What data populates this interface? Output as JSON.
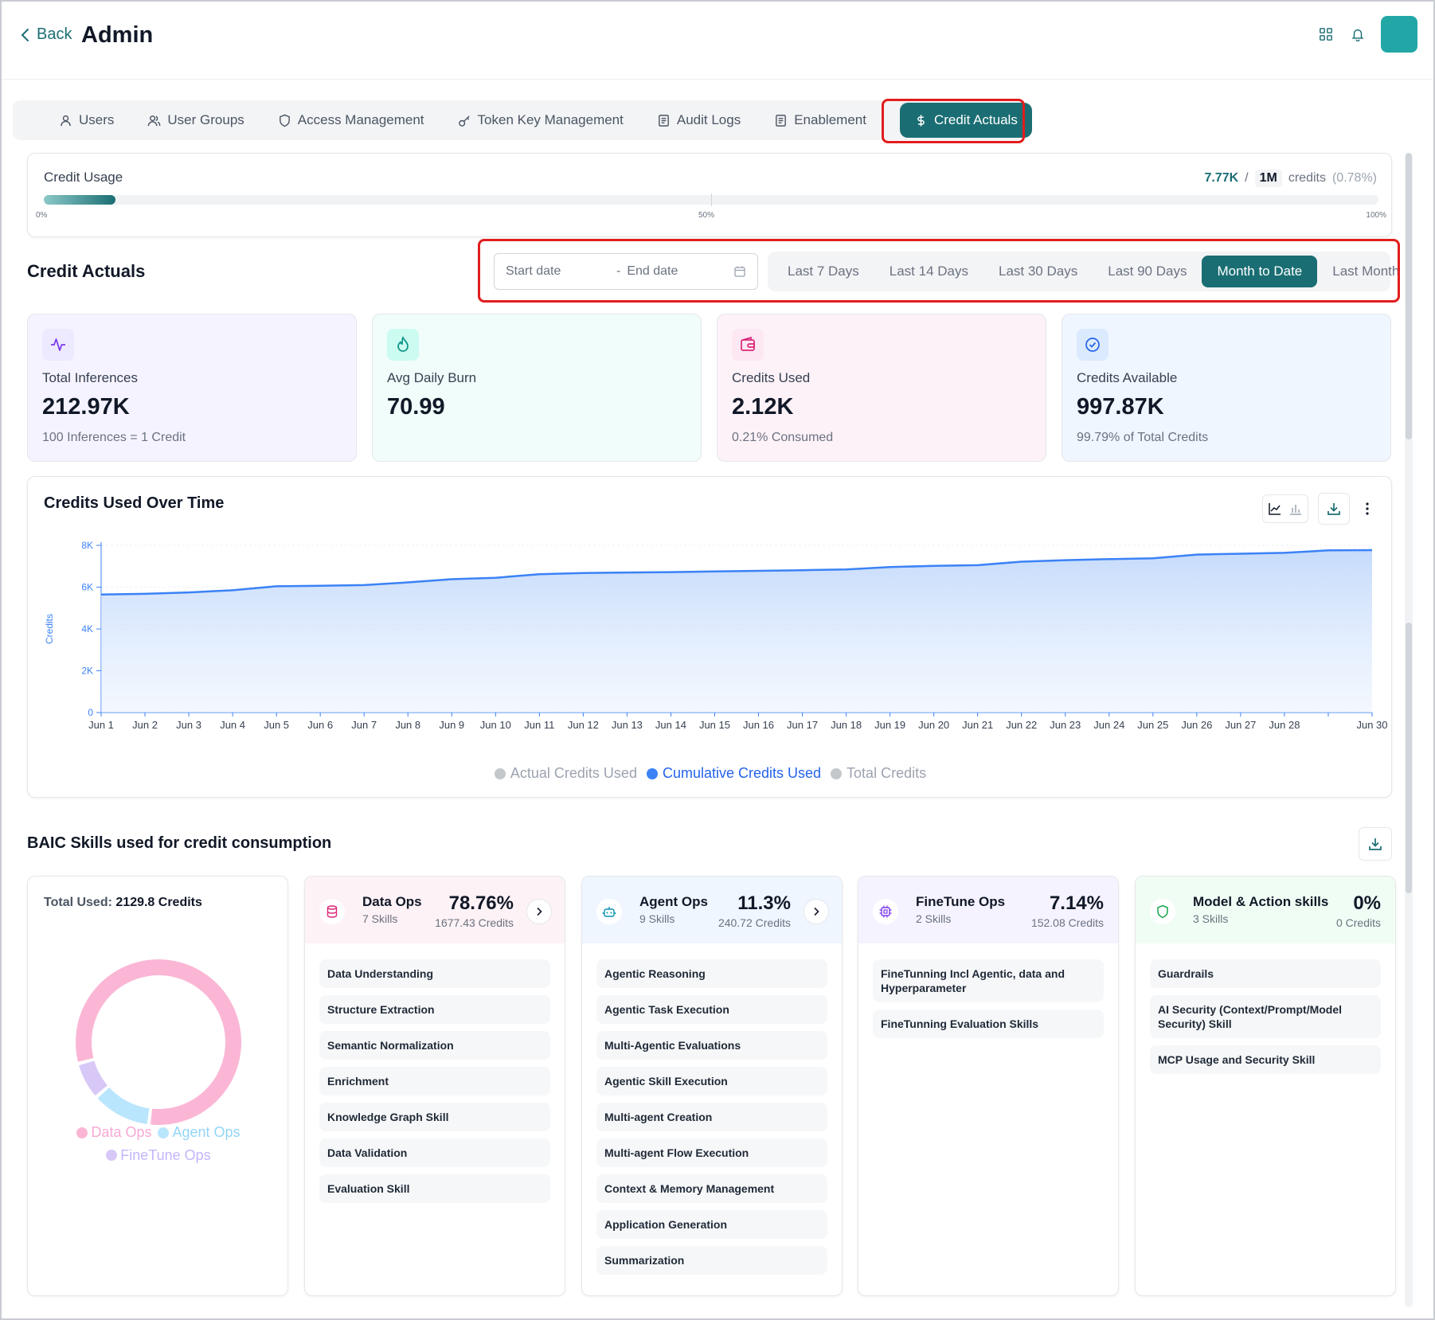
{
  "header": {
    "back_label": "Back",
    "title": "Admin"
  },
  "tabs": [
    {
      "label": "Users",
      "icon": "user-icon"
    },
    {
      "label": "User Groups",
      "icon": "users-icon"
    },
    {
      "label": "Access Management",
      "icon": "shield-icon"
    },
    {
      "label": "Token Key Management",
      "icon": "key-icon"
    },
    {
      "label": "Audit Logs",
      "icon": "log-icon"
    },
    {
      "label": "Enablement",
      "icon": "book-icon"
    },
    {
      "label": "Credit Actuals",
      "icon": "dollar-icon",
      "active": true
    }
  ],
  "usage": {
    "title": "Credit Usage",
    "used": "7.77K",
    "slash": "/",
    "total": "1M",
    "unit": "credits",
    "pct": "(0.78%)",
    "fill_fraction": 0.0078,
    "tick_0": "0%",
    "tick_50": "50%",
    "tick_100": "100%"
  },
  "actuals": {
    "title": "Credit Actuals",
    "start_placeholder": "Start date",
    "dash": "-",
    "end_placeholder": "End date",
    "presets": [
      "Last 7 Days",
      "Last 14 Days",
      "Last 30 Days",
      "Last 90 Days",
      "Month to Date",
      "Last Month"
    ],
    "active_preset": "Month to Date"
  },
  "stats": [
    {
      "label": "Total Inferences",
      "value": "212.97K",
      "sub": "100 Inferences = 1 Credit",
      "icon": "activity-icon",
      "bg": "#f5f3ff",
      "ic_bg": "#ede9fe",
      "ic_color": "#7c3aed"
    },
    {
      "label": "Avg Daily Burn",
      "value": "70.99",
      "sub": "",
      "icon": "flame-icon",
      "bg": "#f0fdfa",
      "ic_bg": "#ccfbf1",
      "ic_color": "#0d9488"
    },
    {
      "label": "Credits Used",
      "value": "2.12K",
      "sub": "0.21% Consumed",
      "icon": "wallet-icon",
      "bg": "#fdf2f8",
      "ic_bg": "#fce7f3",
      "ic_color": "#db2777"
    },
    {
      "label": "Credits Available",
      "value": "997.87K",
      "sub": "99.79% of Total Credits",
      "icon": "check-circle-icon",
      "bg": "#eff6ff",
      "ic_bg": "#dbeafe",
      "ic_color": "#2563eb"
    }
  ],
  "chart": {
    "title": "Credits Used Over Time"
  },
  "chart_data": {
    "type": "area",
    "title": "Credits Used Over Time",
    "ylabel": "Credits",
    "ylim": [
      0,
      8000
    ],
    "yticks": [
      0,
      2000,
      4000,
      6000,
      8000
    ],
    "ytick_labels": [
      "0",
      "2K",
      "4K",
      "6K",
      "8K"
    ],
    "x": [
      "Jun 1",
      "Jun 2",
      "Jun 3",
      "Jun 4",
      "Jun 5",
      "Jun 6",
      "Jun 7",
      "Jun 8",
      "Jun 9",
      "Jun 10",
      "Jun 11",
      "Jun 12",
      "Jun 13",
      "Jun 14",
      "Jun 15",
      "Jun 16",
      "Jun 17",
      "Jun 18",
      "Jun 19",
      "Jun 20",
      "Jun 21",
      "Jun 22",
      "Jun 23",
      "Jun 24",
      "Jun 25",
      "Jun 26",
      "Jun 27",
      "Jun 28",
      "Jun 29",
      "Jun 30"
    ],
    "x_labels_shown": [
      "Jun 1",
      "Jun 2",
      "Jun 3",
      "Jun 4",
      "Jun 5",
      "Jun 6",
      "Jun 7",
      "Jun 8",
      "Jun 9",
      "Jun 10",
      "Jun 11",
      "Jun 12",
      "Jun 13",
      "Jun 14",
      "Jun 15",
      "Jun 16",
      "Jun 17",
      "Jun 18",
      "Jun 19",
      "Jun 20",
      "Jun 21",
      "Jun 22",
      "Jun 23",
      "Jun 24",
      "Jun 25",
      "Jun 26",
      "Jun 27",
      "Jun 28",
      "",
      "Jun 30"
    ],
    "series": [
      {
        "name": "Cumulative Credits Used",
        "color": "#3b82f6",
        "values": [
          5650,
          5680,
          5750,
          5850,
          6040,
          6070,
          6100,
          6230,
          6380,
          6450,
          6620,
          6680,
          6700,
          6720,
          6750,
          6780,
          6810,
          6850,
          6960,
          7020,
          7050,
          7220,
          7290,
          7340,
          7380,
          7560,
          7600,
          7640,
          7760,
          7770
        ]
      }
    ],
    "legend": [
      {
        "name": "Actual Credits Used",
        "color": "#c4c7cc",
        "text_color": "#9ca3af"
      },
      {
        "name": "Cumulative Credits Used",
        "color": "#3b82f6",
        "text_color": "#2563eb"
      },
      {
        "name": "Total Credits",
        "color": "#c4c7cc",
        "text_color": "#9ca3af"
      }
    ],
    "legend_position": "bottom-center",
    "grid": true
  },
  "skills": {
    "title": "BAIC Skills used for credit consumption",
    "total_label": "Total Used:",
    "total_value": "2129.8 Credits",
    "donut": [
      {
        "name": "Data Ops",
        "value": 78.76,
        "color": "#fbb6d6",
        "text_color": "#f9a8d4"
      },
      {
        "name": "Agent Ops",
        "value": 11.3,
        "color": "#bae6fd",
        "text_color": "#93d5f7"
      },
      {
        "name": "FineTune Ops",
        "value": 7.14,
        "color": "#d8c8f7",
        "text_color": "#c4b5fd"
      }
    ],
    "categories": [
      {
        "name": "Data Ops",
        "count": "7 Skills",
        "pct": "78.76%",
        "credits": "1677.43 Credits",
        "icon": "database-icon",
        "head_bg": "#fdf2f6",
        "ic_color": "#db2777",
        "arrow": true,
        "items": [
          "Data Understanding",
          "Structure Extraction",
          "Semantic Normalization",
          "Enrichment",
          "Knowledge Graph Skill",
          "Data Validation",
          "Evaluation Skill"
        ]
      },
      {
        "name": "Agent Ops",
        "count": "9 Skills",
        "pct": "11.3%",
        "credits": "240.72 Credits",
        "icon": "robot-icon",
        "head_bg": "#eff6ff",
        "ic_color": "#0891b2",
        "arrow": true,
        "items": [
          "Agentic Reasoning",
          "Agentic Task Execution",
          "Multi-Agentic Evaluations",
          "Agentic Skill Execution",
          "Multi-agent Creation",
          "Multi-agent Flow Execution",
          "Context & Memory Management",
          "Application Generation",
          "Summarization"
        ]
      },
      {
        "name": "FineTune Ops",
        "count": "2 Skills",
        "pct": "7.14%",
        "credits": "152.08 Credits",
        "icon": "cpu-icon",
        "head_bg": "#f5f3ff",
        "ic_color": "#7c3aed",
        "arrow": false,
        "items": [
          "FineTunning Incl Agentic, data and Hyperparameter",
          "FineTunning Evaluation Skills"
        ]
      },
      {
        "name": "Model & Action skills",
        "count": "3 Skills",
        "pct": "0%",
        "credits": "0 Credits",
        "icon": "shield-icon",
        "head_bg": "#f0fdf4",
        "ic_color": "#16a34a",
        "arrow": false,
        "items": [
          "Guardrails",
          "AI Security (Context/Prompt/Model Security) Skill",
          "MCP Usage and Security Skill"
        ]
      }
    ]
  }
}
